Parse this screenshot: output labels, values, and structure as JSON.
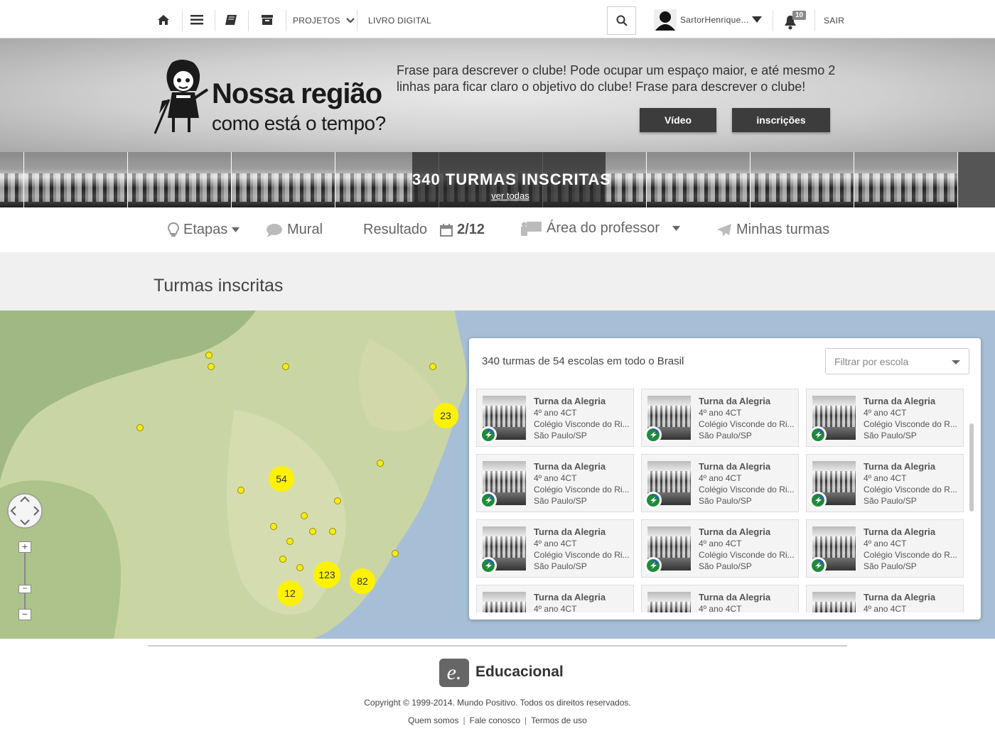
{
  "topbar": {
    "projetos": "PROJETOS",
    "livro_digital": "LIVRO DIGITAL",
    "username": "SartorHenrique...",
    "notifications": "10",
    "sair": "SAIR"
  },
  "banner": {
    "logo_title": "Nossa região",
    "logo_subtitle": "como está o tempo?",
    "description": "Frase para descrever o clube! Pode ocupar um espaço maior, e até mesmo 2 linhas para ficar claro o objetivo do clube! Frase para descrever o clube!",
    "video_label": "Vídeo",
    "inscricoes_label": "inscrições"
  },
  "strip": {
    "count_label": "340 TURMAS INSCRITAS",
    "link_label": "ver todas"
  },
  "nav": {
    "etapas": "Etapas",
    "mural": "Mural",
    "resultado": "Resultado",
    "resultado_count": "2/12",
    "area_professor": "Área do professor",
    "minhas_turmas": "Minhas turmas"
  },
  "section": {
    "title": "Turmas inscritas"
  },
  "map": {
    "clusters": [
      "23",
      "54",
      "123",
      "82",
      "12"
    ]
  },
  "panel": {
    "summary": "340 turmas de 54 escolas em todo o Brasil",
    "filter_placeholder": "Filtrar por escola",
    "cards": [
      {
        "name": "Turna da Alegria",
        "grade": "4º ano 4CT",
        "school": "Colégio Visconde do Ri...",
        "city": "São Paulo/SP"
      },
      {
        "name": "Turna da Alegria",
        "grade": "4º ano 4CT",
        "school": "Colégio Visconde do Ri...",
        "city": "São Paulo/SP"
      },
      {
        "name": "Turna da Alegria",
        "grade": "4º ano 4CT",
        "school": "Colégio Visconde do R...",
        "city": "São Paulo/SP"
      },
      {
        "name": "Turna da Alegria",
        "grade": "4º ano 4CT",
        "school": "Colégio Visconde do Ri...",
        "city": "São Paulo/SP"
      },
      {
        "name": "Turna da Alegria",
        "grade": "4º ano 4CT",
        "school": "Colégio Visconde do Ri...",
        "city": "São Paulo/SP"
      },
      {
        "name": "Turna da Alegria",
        "grade": "4º ano 4CT",
        "school": "Colégio Visconde do R...",
        "city": "São Paulo/SP"
      },
      {
        "name": "Turna da Alegria",
        "grade": "4º ano 4CT",
        "school": "Colégio Visconde do Ri...",
        "city": "São Paulo/SP"
      },
      {
        "name": "Turna da Alegria",
        "grade": "4º ano 4CT",
        "school": "Colégio Visconde do Ri...",
        "city": "São Paulo/SP"
      },
      {
        "name": "Turna da Alegria",
        "grade": "4º ano 4CT",
        "school": "Colégio Visconde do R...",
        "city": "São Paulo/SP"
      },
      {
        "name": "Turna da Alegria",
        "grade": "4º ano 4CT",
        "school": "",
        "city": ""
      },
      {
        "name": "Turna da Alegria",
        "grade": "4º ano 4CT",
        "school": "",
        "city": ""
      },
      {
        "name": "Turna da Alegria",
        "grade": "4º ano 4CT",
        "school": "",
        "city": ""
      }
    ]
  },
  "footer": {
    "brand": "Educacional",
    "logo_glyph": "e.",
    "copyright": "Copyright © 1999-2014. Mundo Positivo. Todos os direitos reservados.",
    "links": [
      "Quem somos",
      "Fale conosco",
      "Termos de uso"
    ]
  },
  "colors": {
    "accent_dark": "#3c3c3c",
    "cluster": "#fff200",
    "map_land": "#c9d6a4",
    "map_water": "#a7bfd6"
  }
}
